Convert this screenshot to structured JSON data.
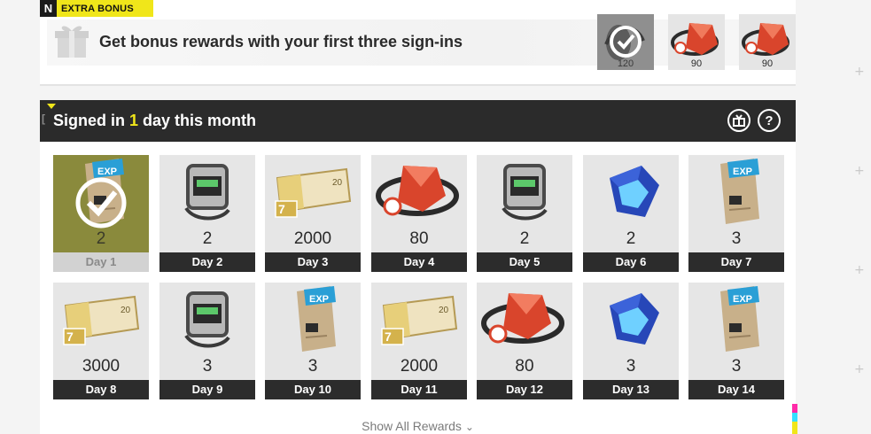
{
  "bonus": {
    "logo": "N",
    "tag": "EXTRA BONUS",
    "title": "Get bonus rewards with your first three sign-ins",
    "rewards": [
      {
        "item": "gem-pack",
        "qty": "120",
        "claimed": true
      },
      {
        "item": "red-crystal",
        "qty": "90",
        "claimed": false
      },
      {
        "item": "red-crystal",
        "qty": "90",
        "claimed": false
      }
    ]
  },
  "month": {
    "title_prefix": "Signed in ",
    "days_signed": "1",
    "title_suffix": " day this month"
  },
  "days": [
    {
      "label": "Day 1",
      "qty": "2",
      "item": "exp-book",
      "claimed": true
    },
    {
      "label": "Day 2",
      "qty": "2",
      "item": "module-chip",
      "claimed": false
    },
    {
      "label": "Day 3",
      "qty": "2000",
      "item": "ticket",
      "claimed": false
    },
    {
      "label": "Day 4",
      "qty": "80",
      "item": "red-crystal",
      "claimed": false
    },
    {
      "label": "Day 5",
      "qty": "2",
      "item": "module-chip",
      "claimed": false
    },
    {
      "label": "Day 6",
      "qty": "2",
      "item": "blue-core",
      "claimed": false
    },
    {
      "label": "Day 7",
      "qty": "3",
      "item": "exp-book",
      "claimed": false
    },
    {
      "label": "Day 8",
      "qty": "3000",
      "item": "ticket",
      "claimed": false
    },
    {
      "label": "Day 9",
      "qty": "3",
      "item": "module-chip",
      "claimed": false
    },
    {
      "label": "Day 10",
      "qty": "3",
      "item": "exp-book",
      "claimed": false
    },
    {
      "label": "Day 11",
      "qty": "2000",
      "item": "ticket",
      "claimed": false
    },
    {
      "label": "Day 12",
      "qty": "80",
      "item": "red-crystal",
      "claimed": false
    },
    {
      "label": "Day 13",
      "qty": "3",
      "item": "blue-core",
      "claimed": false
    },
    {
      "label": "Day 14",
      "qty": "3",
      "item": "exp-book",
      "claimed": false
    }
  ],
  "show_all": "Show All Rewards",
  "icons": {
    "gift": "gift-icon",
    "help": "help-icon",
    "chevron": "chevron-down-icon",
    "check": "checkmark-icon"
  },
  "colors": {
    "accent": "#f0e61a",
    "header": "#2b2b2b",
    "claimed": "#8a8a3c"
  }
}
